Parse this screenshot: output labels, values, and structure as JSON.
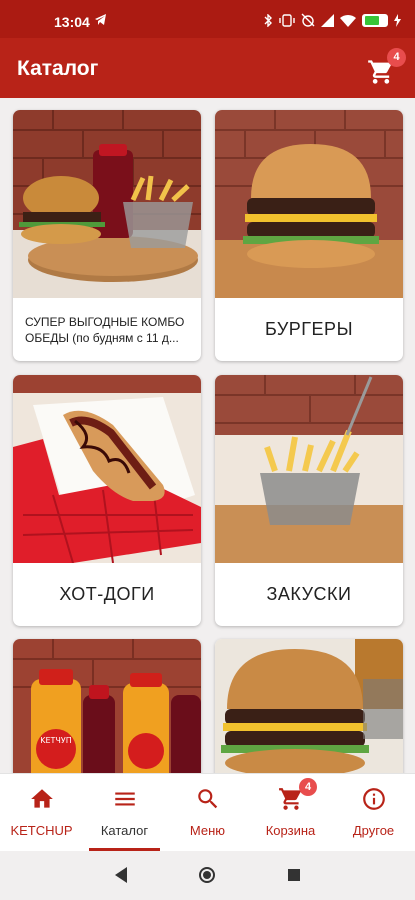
{
  "status_bar": {
    "time": "13:04"
  },
  "app_bar": {
    "title": "Каталог",
    "cart_count": "4"
  },
  "catalog": [
    {
      "label": "СУПЕР ВЫГОДНЫЕ КОМБО ОБЕДЫ (по будням с 11 д..."
    },
    {
      "label": "БУРГЕРЫ"
    },
    {
      "label": "ХОТ-ДОГИ"
    },
    {
      "label": "ЗАКУСКИ"
    },
    {
      "label": ""
    },
    {
      "label": ""
    }
  ],
  "juice_label": "KETЧУП",
  "bottom_nav": {
    "items": [
      {
        "label": "KETCHUP",
        "icon": "home-icon"
      },
      {
        "label": "Каталог",
        "icon": "menu-list-icon"
      },
      {
        "label": "Меню",
        "icon": "search-icon"
      },
      {
        "label": "Корзина",
        "icon": "cart-icon",
        "badge": "4"
      },
      {
        "label": "Другое",
        "icon": "info-icon"
      }
    ]
  },
  "colors": {
    "primary": "#b82318",
    "status_bar": "#ab1b12",
    "badge": "#e84d4d",
    "background": "#f1efef"
  }
}
